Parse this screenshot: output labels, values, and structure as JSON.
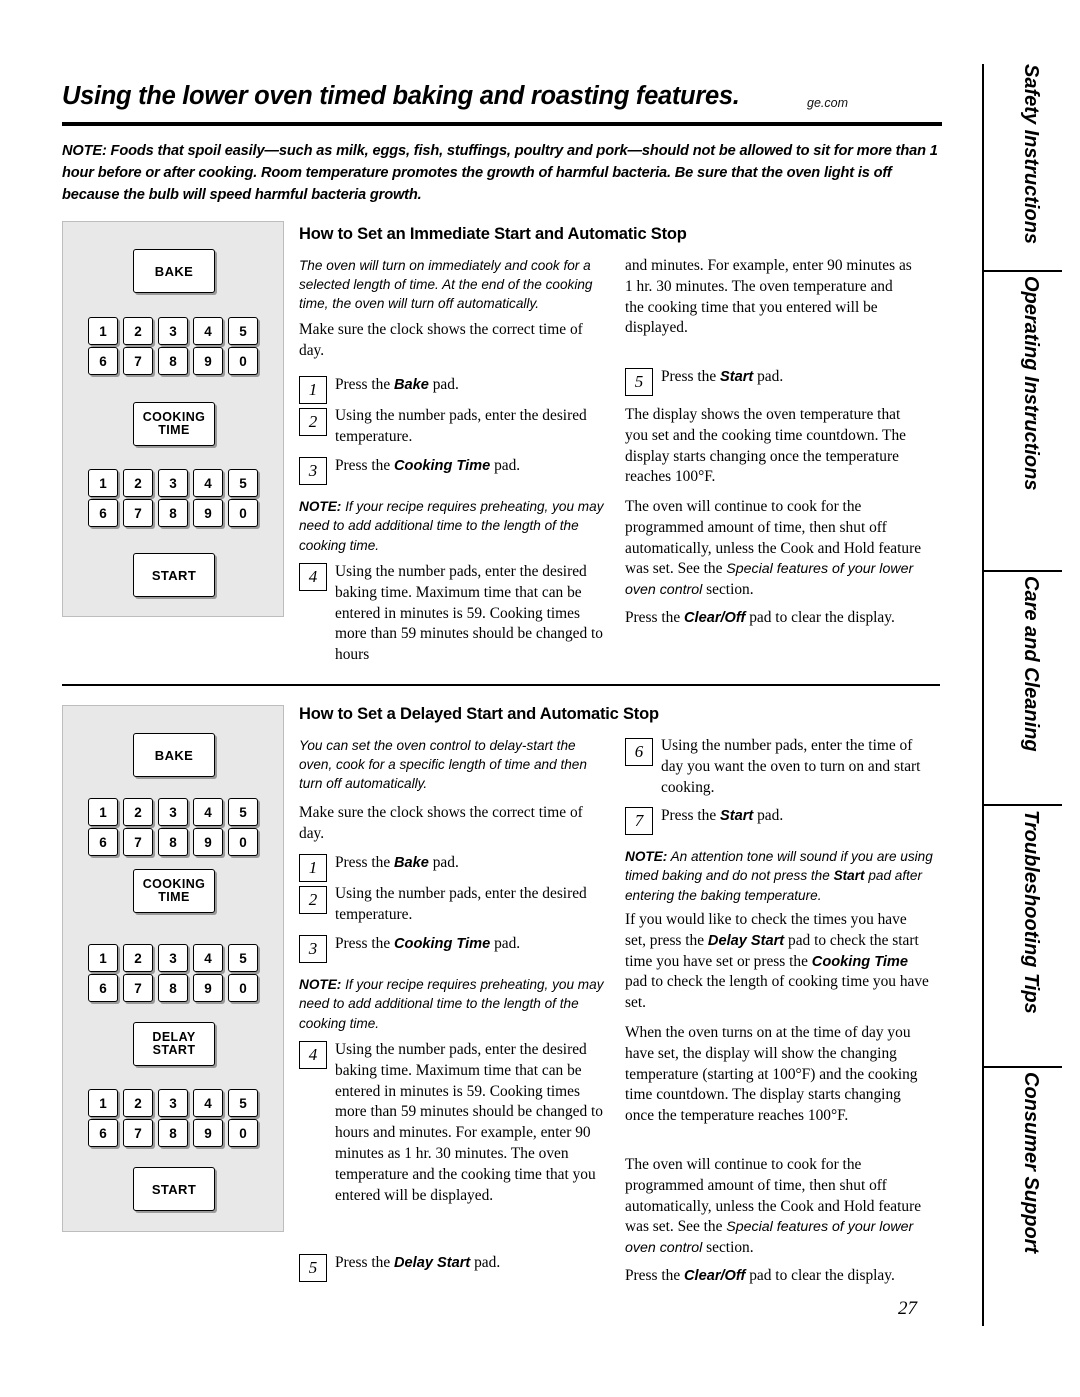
{
  "header": {
    "title": "Using the lower oven timed baking and roasting features.",
    "site": "ge.com"
  },
  "top_note": {
    "lead": "NOTE:",
    "text": " Foods that spoil easily—such as milk, eggs, fish, stuffings, poultry and pork—should not be allowed to sit for more than 1 hour before or after cooking. Room temperature promotes the growth of harmful bacteria. Be sure that the oven light is off because the bulb will speed harmful bacteria growth."
  },
  "sidebar": {
    "tabs": [
      {
        "label": "Safety Instructions"
      },
      {
        "label": "Operating Instructions"
      },
      {
        "label": "Care and Cleaning"
      },
      {
        "label": "Troubleshooting Tips"
      },
      {
        "label": "Consumer Support"
      }
    ]
  },
  "section1": {
    "heading": "How to Set an Immediate Start and Automatic Stop",
    "intro": "The oven will turn on immediately and cook for a selected length of time. At the end of the cooking time, the oven will turn off automatically.",
    "clock_line": "Make sure the clock shows the correct time of day.",
    "steps": [
      {
        "num": "1",
        "pre": "Press the ",
        "bold": "Bake",
        "post": " pad."
      },
      {
        "num": "2",
        "pre": "Using the number pads, enter the desired temperature.",
        "bold": "",
        "post": ""
      },
      {
        "num": "3",
        "pre": "Press the ",
        "bold": "Cooking Time",
        "post": " pad."
      },
      {
        "num": "4",
        "pre": "Using the number pads, enter the desired baking time. Maximum time that can be entered in minutes is 59. Cooking times more than 59 minutes should be changed to hours",
        "bold": "",
        "post": ""
      },
      {
        "num": "5",
        "pre": "Press the ",
        "bold": "Start",
        "post": " pad."
      }
    ],
    "note_preheat": {
      "lead": "NOTE:",
      "text": " If your recipe requires preheating, you may need to add additional time to the length of the cooking time."
    },
    "right_col": {
      "continued": "and minutes. For example, enter 90 minutes as 1 hr. 30 minutes. The oven temperature and the cooking time that you entered will be displayed.",
      "p1": "The display shows the oven temperature that you set and the cooking time countdown. The display starts changing once the temperature reaches 100°F.",
      "p2a": "The oven will continue to cook for the programmed amount of time, then shut off automatically, unless the Cook and Hold feature was set. See the ",
      "p2_ital": "Special features of your lower oven control",
      "p2b": " section.",
      "p3a": "Press the ",
      "p3_bold": "Clear/Off",
      "p3b": " pad to clear the display."
    },
    "keypad": {
      "bake": "BAKE",
      "cooking_time_line1": "COOKING",
      "cooking_time_line2": "TIME",
      "start": "START",
      "numbers_row1": [
        "1",
        "2",
        "3",
        "4",
        "5"
      ],
      "numbers_row2": [
        "6",
        "7",
        "8",
        "9",
        "0"
      ]
    }
  },
  "section2": {
    "heading": "How to Set a Delayed Start and Automatic Stop",
    "intro": "You can set the oven control to delay-start the oven, cook for a specific length of time and then turn off automatically.",
    "clock_line": "Make sure the clock shows the correct time of day.",
    "steps": [
      {
        "num": "1",
        "pre": "Press the ",
        "bold": "Bake",
        "post": " pad."
      },
      {
        "num": "2",
        "pre": "Using the number pads, enter the desired temperature.",
        "bold": "",
        "post": ""
      },
      {
        "num": "3",
        "pre": "Press the ",
        "bold": "Cooking Time",
        "post": " pad."
      },
      {
        "num": "4",
        "pre": "Using the number pads, enter the desired baking time. Maximum time that can be entered in minutes is 59. Cooking times more than 59 minutes should be changed to hours and minutes. For example, enter 90 minutes as 1 hr. 30 minutes. The oven temperature and the cooking time that you entered will be displayed.",
        "bold": "",
        "post": ""
      },
      {
        "num": "5",
        "pre": "Press the ",
        "bold": "Delay Start",
        "post": " pad."
      },
      {
        "num": "6",
        "pre": "Using the number pads, enter the time of day you want the oven to turn on and start cooking.",
        "bold": "",
        "post": ""
      },
      {
        "num": "7",
        "pre": "Press the ",
        "bold": "Start",
        "post": " pad."
      }
    ],
    "note_preheat": {
      "lead": "NOTE:",
      "text": " If your recipe requires preheating, you may need to add additional time to the length of the cooking time."
    },
    "note_tone": {
      "lead": "NOTE:",
      "a": " An attention tone will sound if you are using timed baking and do not press the ",
      "bold": "Start",
      "b": " pad after entering the baking temperature."
    },
    "right_col": {
      "p1a": "If you would like to check the times you have set, press the ",
      "p1_b1": "Delay Start",
      "p1b": " pad to check the start time you have set or press the ",
      "p1_b2": "Cooking Time",
      "p1c": " pad to check the length of cooking time you have set.",
      "p2": "When the oven turns on at the time of day you have set, the display will show the changing temperature (starting at 100°F) and the cooking time countdown. The display starts changing once the temperature reaches 100°F.",
      "p3a": "The oven will continue to cook for the programmed amount of time, then shut off automatically, unless the Cook and Hold feature was set. See the ",
      "p3_ital": "Special features of your lower oven control",
      "p3b": " section.",
      "p4a": "Press the ",
      "p4_bold": "Clear/Off",
      "p4b": " pad to clear the display."
    },
    "keypad": {
      "bake": "BAKE",
      "cooking_time_line1": "COOKING",
      "cooking_time_line2": "TIME",
      "delay_line1": "DELAY",
      "delay_line2": "START",
      "start": "START",
      "numbers_row1": [
        "1",
        "2",
        "3",
        "4",
        "5"
      ],
      "numbers_row2": [
        "6",
        "7",
        "8",
        "9",
        "0"
      ]
    }
  },
  "footer": {
    "page_number": "27"
  }
}
